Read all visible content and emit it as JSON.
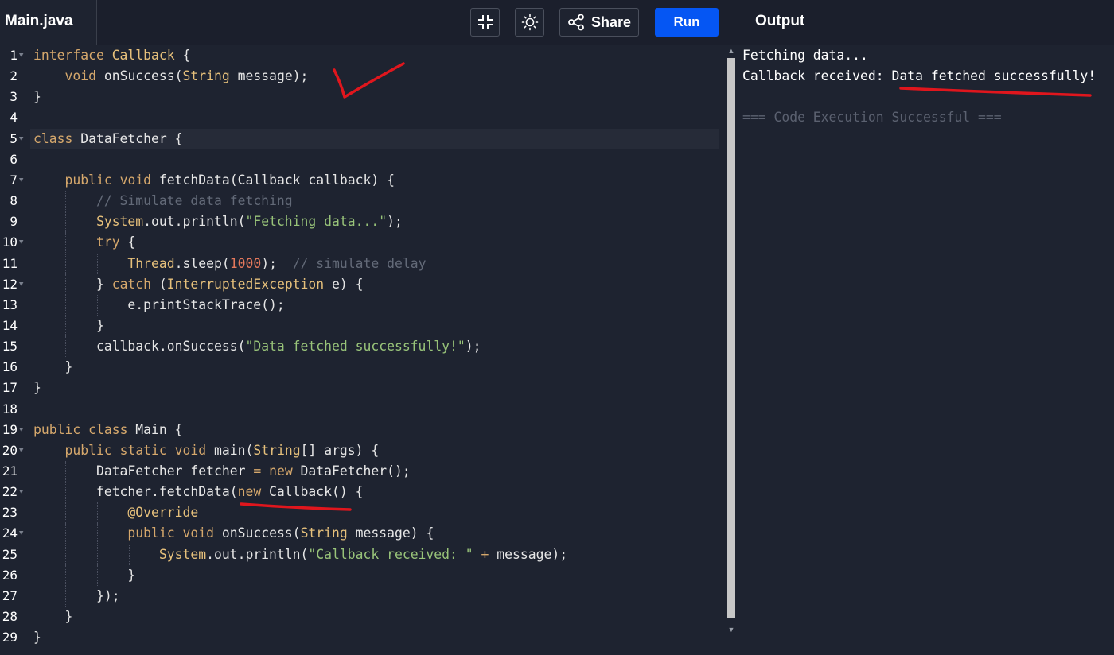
{
  "tab": {
    "filename": "Main.java"
  },
  "toolbar": {
    "share_label": "Share",
    "run_label": "Run",
    "icons": {
      "fullscreen": "collapse-icon",
      "theme": "sun-icon",
      "share": "share-icon"
    }
  },
  "output_panel": {
    "title": "Output",
    "lines": [
      "Fetching data...",
      "Callback received: Data fetched successfully!",
      "",
      "=== Code Execution Successful ==="
    ]
  },
  "editor": {
    "language": "java",
    "active_line": 5,
    "lines": [
      {
        "n": "1",
        "fold": true,
        "indent": 0,
        "tokens": [
          [
            "kw",
            "interface"
          ],
          [
            "pl",
            " "
          ],
          [
            "ty",
            "Callback"
          ],
          [
            "pl",
            " {"
          ]
        ]
      },
      {
        "n": "2",
        "fold": false,
        "indent": 1,
        "tokens": [
          [
            "kw",
            "void"
          ],
          [
            "pl",
            " onSuccess("
          ],
          [
            "ty",
            "String"
          ],
          [
            "pl",
            " message);"
          ]
        ]
      },
      {
        "n": "3",
        "fold": false,
        "indent": 0,
        "tokens": [
          [
            "pl",
            "}"
          ]
        ]
      },
      {
        "n": "4",
        "fold": false,
        "indent": 0,
        "tokens": []
      },
      {
        "n": "5",
        "fold": true,
        "indent": 0,
        "tokens": [
          [
            "kw",
            "class"
          ],
          [
            "pl",
            " DataFetcher {"
          ]
        ]
      },
      {
        "n": "6",
        "fold": false,
        "indent": 0,
        "tokens": []
      },
      {
        "n": "7",
        "fold": true,
        "indent": 1,
        "tokens": [
          [
            "kw",
            "public"
          ],
          [
            "pl",
            " "
          ],
          [
            "kw",
            "void"
          ],
          [
            "pl",
            " fetchData(Callback callback) {"
          ]
        ]
      },
      {
        "n": "8",
        "fold": false,
        "indent": 2,
        "tokens": [
          [
            "com",
            "// Simulate data fetching"
          ]
        ]
      },
      {
        "n": "9",
        "fold": false,
        "indent": 2,
        "tokens": [
          [
            "ty",
            "System"
          ],
          [
            "pl",
            ".out.println("
          ],
          [
            "str",
            "\"Fetching data...\""
          ],
          [
            "pl",
            ");"
          ]
        ]
      },
      {
        "n": "10",
        "fold": true,
        "indent": 2,
        "tokens": [
          [
            "kw",
            "try"
          ],
          [
            "pl",
            " {"
          ]
        ]
      },
      {
        "n": "11",
        "fold": false,
        "indent": 3,
        "tokens": [
          [
            "ty",
            "Thread"
          ],
          [
            "pl",
            ".sleep("
          ],
          [
            "num",
            "1000"
          ],
          [
            "pl",
            ");  "
          ],
          [
            "com",
            "// simulate delay"
          ]
        ]
      },
      {
        "n": "12",
        "fold": true,
        "indent": 2,
        "tokens": [
          [
            "pl",
            "} "
          ],
          [
            "kw",
            "catch"
          ],
          [
            "pl",
            " ("
          ],
          [
            "ty",
            "InterruptedException"
          ],
          [
            "pl",
            " e) {"
          ]
        ]
      },
      {
        "n": "13",
        "fold": false,
        "indent": 3,
        "tokens": [
          [
            "pl",
            "e.printStackTrace();"
          ]
        ]
      },
      {
        "n": "14",
        "fold": false,
        "indent": 2,
        "tokens": [
          [
            "pl",
            "}"
          ]
        ]
      },
      {
        "n": "15",
        "fold": false,
        "indent": 2,
        "tokens": [
          [
            "pl",
            "callback.onSuccess("
          ],
          [
            "str",
            "\"Data fetched successfully!\""
          ],
          [
            "pl",
            ");"
          ]
        ]
      },
      {
        "n": "16",
        "fold": false,
        "indent": 1,
        "tokens": [
          [
            "pl",
            "}"
          ]
        ]
      },
      {
        "n": "17",
        "fold": false,
        "indent": 0,
        "tokens": [
          [
            "pl",
            "}"
          ]
        ]
      },
      {
        "n": "18",
        "fold": false,
        "indent": 0,
        "tokens": []
      },
      {
        "n": "19",
        "fold": true,
        "indent": 0,
        "tokens": [
          [
            "kw",
            "public"
          ],
          [
            "pl",
            " "
          ],
          [
            "kw",
            "class"
          ],
          [
            "pl",
            " Main {"
          ]
        ]
      },
      {
        "n": "20",
        "fold": true,
        "indent": 1,
        "tokens": [
          [
            "kw",
            "public"
          ],
          [
            "pl",
            " "
          ],
          [
            "kw",
            "static"
          ],
          [
            "pl",
            " "
          ],
          [
            "kw",
            "void"
          ],
          [
            "pl",
            " main("
          ],
          [
            "ty",
            "String"
          ],
          [
            "pl",
            "[] args) {"
          ]
        ]
      },
      {
        "n": "21",
        "fold": false,
        "indent": 2,
        "tokens": [
          [
            "pl",
            "DataFetcher fetcher "
          ],
          [
            "kw",
            "="
          ],
          [
            "pl",
            " "
          ],
          [
            "kw",
            "new"
          ],
          [
            "pl",
            " DataFetcher();"
          ]
        ]
      },
      {
        "n": "22",
        "fold": true,
        "indent": 2,
        "tokens": [
          [
            "pl",
            "fetcher.fetchData("
          ],
          [
            "kw",
            "new"
          ],
          [
            "pl",
            " Callback() {"
          ]
        ]
      },
      {
        "n": "23",
        "fold": false,
        "indent": 3,
        "tokens": [
          [
            "ty",
            "@Override"
          ]
        ]
      },
      {
        "n": "24",
        "fold": true,
        "indent": 3,
        "tokens": [
          [
            "kw",
            "public"
          ],
          [
            "pl",
            " "
          ],
          [
            "kw",
            "void"
          ],
          [
            "pl",
            " onSuccess("
          ],
          [
            "ty",
            "String"
          ],
          [
            "pl",
            " message) {"
          ]
        ]
      },
      {
        "n": "25",
        "fold": false,
        "indent": 4,
        "tokens": [
          [
            "ty",
            "System"
          ],
          [
            "pl",
            ".out.println("
          ],
          [
            "str",
            "\"Callback received: \""
          ],
          [
            "pl",
            " "
          ],
          [
            "kw",
            "+"
          ],
          [
            "pl",
            " message);"
          ]
        ]
      },
      {
        "n": "26",
        "fold": false,
        "indent": 3,
        "tokens": [
          [
            "pl",
            "}"
          ]
        ]
      },
      {
        "n": "27",
        "fold": false,
        "indent": 2,
        "tokens": [
          [
            "pl",
            "});"
          ]
        ]
      },
      {
        "n": "28",
        "fold": false,
        "indent": 1,
        "tokens": [
          [
            "pl",
            "}"
          ]
        ]
      },
      {
        "n": "29",
        "fold": false,
        "indent": 0,
        "tokens": [
          [
            "pl",
            "}"
          ]
        ]
      }
    ]
  },
  "colors": {
    "run_button": "#0556f3",
    "annotation": "#e0161d",
    "keyword": "#d6a86c",
    "type": "#e6c07b",
    "string": "#98c379",
    "number": "#e4785c",
    "comment": "#636a78"
  }
}
